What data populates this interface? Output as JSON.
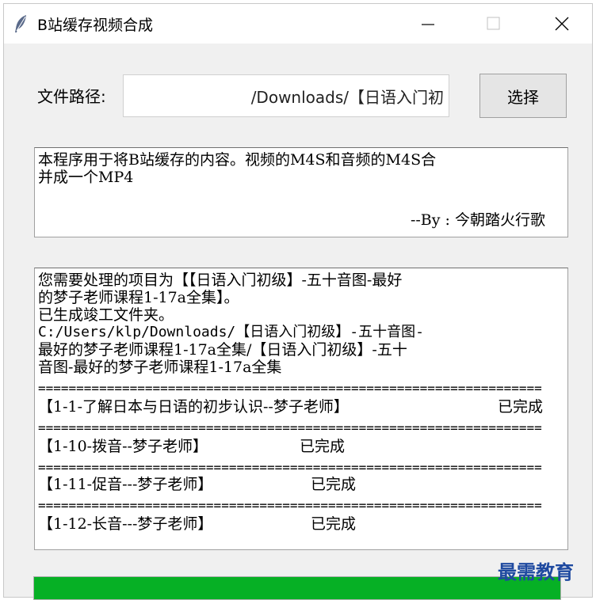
{
  "window": {
    "title": "B站缓存视频合成",
    "controls": {
      "minimize": "minimize-icon",
      "maximize": "maximize-icon",
      "close": "close-icon"
    }
  },
  "path_row": {
    "label": "文件路径:",
    "value": "/Downloads/【日语入门初",
    "button_label": "选择"
  },
  "description": {
    "line1": "本程序用于将B站缓存的内容。视频的M4S和音频的M4S合",
    "line2": "并成一个MP4",
    "author": "--By : 今朝踏火行歌"
  },
  "log": {
    "intro_lines": [
      "您需要处理的项目为【【日语入门初级】-五十音图-最好",
      "的梦子老师课程1-17a全集】。",
      "已生成竣工文件夹。",
      "C:/Users/klp/Downloads/【日语入门初级】-五十音图-",
      "最好的梦子老师课程1-17a全集/【日语入门初级】-五十",
      "音图-最好的梦子老师课程1-17a全集"
    ],
    "separator": "==================================================================",
    "items": [
      {
        "name": "【1-1-了解日本与日语的初步认识--梦子老师】",
        "status": "已完成"
      },
      {
        "name": "【1-10-拨音--梦子老师】",
        "status": "已完成"
      },
      {
        "name": "【1-11-促音---梦子老师】",
        "status": "已完成"
      },
      {
        "name": "【1-12-长音---梦子老师】",
        "status": "已完成"
      }
    ]
  },
  "progress": {
    "fraction": 1.0,
    "color": "#06b025"
  },
  "watermark": "最需教育"
}
